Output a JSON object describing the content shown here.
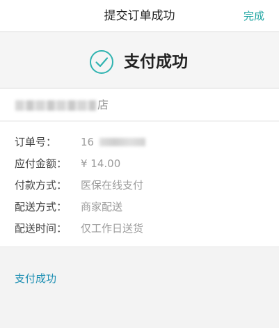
{
  "header": {
    "title": "提交订单成功",
    "done_label": "完成"
  },
  "banner": {
    "icon": "check-circle-icon",
    "title": "支付成功"
  },
  "store": {
    "name_visible_suffix": "店"
  },
  "details": [
    {
      "label": "订单号：",
      "value": "16"
    },
    {
      "label": "应付金额：",
      "value": "¥ 14.00"
    },
    {
      "label": "付款方式：",
      "value": "医保在线支付"
    },
    {
      "label": "配送方式：",
      "value": "商家配送"
    },
    {
      "label": "配送时间：",
      "value": "仅工作日送货"
    }
  ],
  "footer": {
    "link_label": "支付成功"
  },
  "colors": {
    "accent": "#1aa3a0",
    "link": "#1e8fb3",
    "background": "#f3f3f3"
  }
}
